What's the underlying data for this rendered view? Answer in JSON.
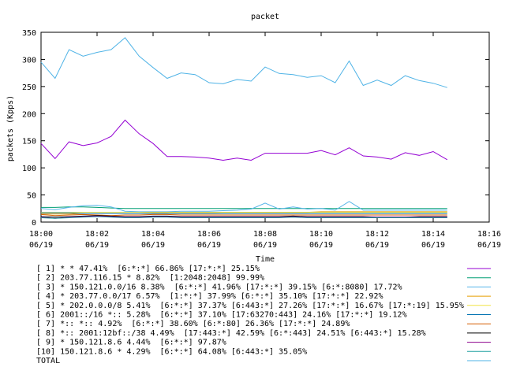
{
  "chart_data": {
    "type": "line",
    "title": "packet",
    "xlabel": "Time",
    "ylabel": "packets (Kpps)",
    "ylim": [
      0,
      350
    ],
    "xlim_minutes": [
      0,
      16
    ],
    "grid": false,
    "legend_placement": "bottom",
    "y_ticks": [
      "0",
      "50",
      "100",
      "150",
      "200",
      "250",
      "300",
      "350"
    ],
    "x_ticks": [
      {
        "minute": 0,
        "time": "18:00",
        "date": "06/19"
      },
      {
        "minute": 2,
        "time": "18:02",
        "date": "06/19"
      },
      {
        "minute": 4,
        "time": "18:04",
        "date": "06/19"
      },
      {
        "minute": 6,
        "time": "18:06",
        "date": "06/19"
      },
      {
        "minute": 8,
        "time": "18:08",
        "date": "06/19"
      },
      {
        "minute": 10,
        "time": "18:10",
        "date": "06/19"
      },
      {
        "minute": 12,
        "time": "18:12",
        "date": "06/19"
      },
      {
        "minute": 14,
        "time": "18:14",
        "date": "06/19"
      },
      {
        "minute": 16,
        "time": "18:16",
        "date": "06/19"
      }
    ],
    "x": [
      0,
      0.5,
      1,
      1.5,
      2,
      2.5,
      3,
      3.5,
      4,
      4.5,
      5,
      5.5,
      6,
      6.5,
      7,
      7.5,
      8,
      8.5,
      9,
      9.5,
      10,
      10.5,
      11,
      11.5,
      12,
      12.5,
      13,
      13.5,
      14,
      14.5,
      15
    ],
    "series": [
      {
        "name": "[ 1] * * 47.41%  [6:*:*] 66.86% [17:*:*] 25.15%",
        "color": "#9400d3",
        "values": [
          145,
          117,
          148,
          141,
          146,
          158,
          188,
          163,
          145,
          121,
          121,
          120,
          118,
          114,
          118,
          114,
          127,
          127,
          127,
          127,
          132,
          124,
          137,
          122,
          120,
          116,
          128,
          123,
          130,
          115
        ]
      },
      {
        "name": "[ 2] 203.77.116.15 * 8.82%  [1:2048:2048] 99.99%",
        "color": "#009e73",
        "values": [
          27,
          27,
          28,
          28,
          27,
          26,
          25,
          25,
          25,
          25,
          25,
          25,
          25,
          25,
          25,
          25,
          25,
          25,
          25,
          25,
          25,
          25,
          25,
          25,
          25,
          25,
          25,
          25,
          25,
          25
        ]
      },
      {
        "name": "[ 3] * 150.121.0.0/16 8.38%  [6:*:*] 41.96% [17:*:*] 39.15% [6:*:8080] 17.72%",
        "color": "#56b4e9",
        "values": [
          25,
          23,
          27,
          30,
          31,
          28,
          20,
          19,
          19,
          19,
          20,
          20,
          20,
          21,
          22,
          24,
          35,
          24,
          28,
          24,
          25,
          22,
          38,
          22,
          22,
          22,
          22,
          22,
          22,
          22
        ]
      },
      {
        "name": "[ 4] * 203.77.0.0/17 6.57%  [1:*:*] 37.99% [6:*:*] 35.10% [17:*:*] 22.92%",
        "color": "#e69f00",
        "values": [
          15,
          15,
          15,
          16,
          16,
          16,
          16,
          16,
          17,
          17,
          17,
          17,
          17,
          18,
          18,
          18,
          18,
          18,
          18,
          18,
          19,
          19,
          19,
          19,
          19,
          19,
          19,
          19,
          19,
          19
        ]
      },
      {
        "name": "[ 5] * 202.0.0.0/8 5.41%  [6:*:*] 37.37% [6:443:*] 27.26% [17:*:*] 16.67% [17:*:19] 15.95%",
        "color": "#f0e442",
        "values": [
          18,
          18,
          18,
          18,
          18,
          18,
          18,
          18,
          18,
          18,
          18,
          18,
          18,
          18,
          18,
          18,
          18,
          18,
          18,
          18,
          18,
          18,
          18,
          18,
          18,
          18,
          18,
          18,
          18,
          18
        ]
      },
      {
        "name": "[ 6] 2001::/16 *:: 5.28%  [6:*:*] 37.10% [17:63270:443] 24.16% [17:*:*] 19.12%",
        "color": "#0072b2",
        "values": [
          17,
          17,
          17,
          16,
          16,
          16,
          16,
          16,
          16,
          16,
          16,
          16,
          16,
          16,
          16,
          16,
          16,
          16,
          16,
          16,
          16,
          16,
          16,
          16,
          16,
          16,
          16,
          16,
          16,
          16
        ]
      },
      {
        "name": "[ 7] *:: *:: 4.92%  [6:*:*] 38.60% [6:*:80] 26.36% [17:*:*] 24.89%",
        "color": "#d55e00",
        "values": [
          14,
          12,
          13,
          14,
          13,
          12,
          13,
          13,
          14,
          14,
          13,
          13,
          13,
          13,
          13,
          13,
          13,
          13,
          13,
          13,
          13,
          13,
          13,
          13,
          13,
          13,
          13,
          13,
          13,
          13
        ]
      },
      {
        "name": "[ 8] *:: 2001:12bf::/38 4.49%  [17:443:*] 42.59% [6:*:443] 24.51% [6:443:*] 15.28%",
        "color": "#000000",
        "values": [
          10,
          9,
          10,
          11,
          12,
          11,
          10,
          10,
          11,
          11,
          10,
          10,
          10,
          10,
          10,
          10,
          10,
          10,
          11,
          10,
          10,
          10,
          10,
          10,
          9,
          9,
          9,
          10,
          10,
          10
        ]
      },
      {
        "name": "[ 9] * 150.121.8.6 4.44%  [6:*:*] 97.87%",
        "color": "#8b008b",
        "values": [
          9,
          7,
          9,
          10,
          11,
          10,
          9,
          9,
          10,
          10,
          9,
          9,
          9,
          9,
          9,
          9,
          9,
          9,
          10,
          9,
          9,
          9,
          9,
          9,
          9,
          9,
          9,
          9,
          9,
          9
        ]
      },
      {
        "name": "[10] 150.121.8.6 * 4.29%  [6:*:*] 64.08% [6:443:*] 35.05%",
        "color": "#20a0a0",
        "values": [
          8,
          7,
          8,
          9,
          10,
          9,
          8,
          8,
          9,
          9,
          8,
          8,
          8,
          8,
          8,
          8,
          8,
          8,
          9,
          8,
          8,
          8,
          8,
          8,
          8,
          8,
          8,
          8,
          8,
          8
        ]
      },
      {
        "name": "TOTAL",
        "color": "#4fb3e6",
        "values": [
          295,
          265,
          318,
          306,
          313,
          318,
          340,
          306,
          285,
          265,
          275,
          272,
          257,
          255,
          263,
          260,
          286,
          274,
          272,
          267,
          270,
          257,
          297,
          252,
          262,
          252,
          270,
          261,
          256,
          248
        ]
      }
    ]
  }
}
